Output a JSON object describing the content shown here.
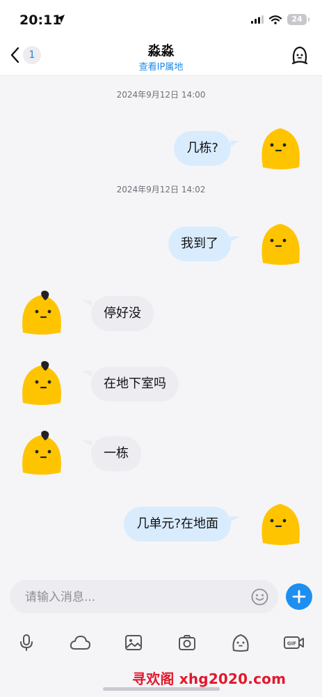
{
  "status_bar": {
    "time": "20:11",
    "battery": "24"
  },
  "header": {
    "unread_count": "1",
    "title": "淼淼",
    "subtitle": "查看IP属地"
  },
  "messages": [
    {
      "type": "timestamp",
      "text": "2024年9月12日 14:00"
    },
    {
      "type": "outgoing",
      "text": "几栋?"
    },
    {
      "type": "timestamp",
      "text": "2024年9月12日 14:02"
    },
    {
      "type": "outgoing",
      "text": "我到了"
    },
    {
      "type": "incoming",
      "text": "停好没"
    },
    {
      "type": "incoming",
      "text": "在地下室吗"
    },
    {
      "type": "incoming",
      "text": "一栋"
    },
    {
      "type": "outgoing",
      "text": "几单元?在地面"
    }
  ],
  "input": {
    "placeholder": "请输入消息..."
  },
  "toolbar_icons": [
    "microphone-icon",
    "cloud-icon",
    "image-icon",
    "camera-icon",
    "emoji-face-icon",
    "gif-icon"
  ],
  "watermark": "寻欢阁 xhg2020.com",
  "colors": {
    "outgoing_bubble": "#d9ecfd",
    "incoming_bubble": "#ececf1",
    "accent": "#1e8ef0",
    "avatar_yellow": "#ffc400"
  }
}
